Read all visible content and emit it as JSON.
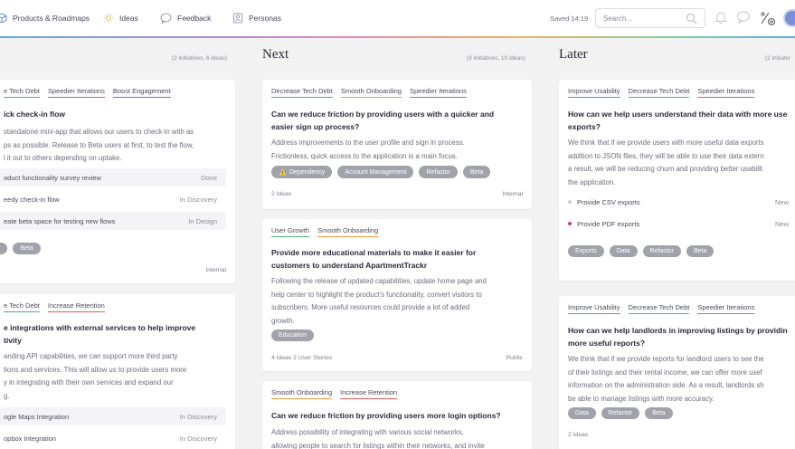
{
  "colors": {
    "tech_debt": "#3fb2a8",
    "speedier": "#e0578d",
    "engagement": "#8a6bd6",
    "onboarding": "#ee9b3c",
    "retention": "#e55a5a",
    "growth": "#4cb77a",
    "usability": "#5b8fd8",
    "new_dot": "#c03d8a",
    "new_dot_light": "#cfcfd6"
  },
  "nav": {
    "products": "Products & Roadmaps",
    "ideas": "Ideas",
    "feedback": "Feedback",
    "personas": "Personas"
  },
  "topbar": {
    "saved": "Saved 14:19",
    "search_placeholder": "Search..."
  },
  "columns": {
    "now": {
      "meta": "(2 initiatives, 6 ideas)",
      "cards": [
        {
          "tags": [
            "e Tech Debt",
            "Speedier Iterations",
            "Boost Engagement"
          ],
          "title": "ick check-in flow",
          "desc": [
            "standalone mini-app that allows our users to check-in with as",
            "ps as possible. Release to Beta users at first, to test the flow,",
            "l it out to others depending on uptake."
          ],
          "subitems": [
            {
              "name": "oduct functionality survey review",
              "status": "Done"
            },
            {
              "name": "eedy check-in flow",
              "status": "In Discovery"
            },
            {
              "name": "eate beta space for testing new flows",
              "status": "In Design"
            }
          ],
          "pills": [
            "r",
            "Beta"
          ],
          "visibility": "Internal"
        },
        {
          "tags": [
            "e Tech Debt",
            "Increase Retention"
          ],
          "title": [
            "e integrations with external services to help improve",
            "tivity"
          ],
          "desc": [
            "anding API capabilities, we can support more third party",
            "tions and services. This will allow us to provide users more",
            "y in integrating with their own services and expand our",
            "g."
          ],
          "subitems": [
            {
              "name": "ogle Maps Integration",
              "status": "In Discovery"
            },
            {
              "name": "opbox Integration",
              "status": "In Discovery"
            }
          ]
        }
      ]
    },
    "next": {
      "title": "Next",
      "meta": "(3 initiatives, 10 ideas)",
      "cards": [
        {
          "tags": [
            "Decrease Tech Debt",
            "Smooth Onboarding",
            "Speedier Iterations"
          ],
          "title": [
            "Can we reduce friction by providing users with a quicker and",
            "easier sign up process?"
          ],
          "desc": [
            "Address improvements to the user profile and sign in process.",
            "Frictionless, quick access to the application is a main focus."
          ],
          "pills": [
            "Dependency",
            "Account Management",
            "Refactor",
            "Beta"
          ],
          "ideas": "2 Ideas",
          "visibility": "Internal"
        },
        {
          "tags": [
            "User Growth",
            "Smooth Onboarding"
          ],
          "title": [
            "Provide more educational materials to make it easier for",
            "customers to understand ApartmentTrackr"
          ],
          "desc": [
            "Following the release of updated capabilities, update home page and",
            "help center to highlight the product's functionality, convert visitors to",
            "subscribers. More useful resources could provide a lot of added",
            "growth."
          ],
          "pills": [
            "Education"
          ],
          "ideas": "4 Ideas  2 User Stories",
          "visibility": "Public"
        },
        {
          "tags": [
            "Smooth Onboarding",
            "Increase Retention"
          ],
          "title": [
            "Can we reduce friction by providing users more login options?"
          ],
          "desc": [
            "Address possibility of integrating with various social networks,",
            "allowing people to search for listings within their networks, and invite"
          ]
        }
      ]
    },
    "later": {
      "title": "Later",
      "meta": "(2 initiativ",
      "cards": [
        {
          "tags": [
            "Improve Usability",
            "Decrease Tech Debt",
            "Speedier Iterations"
          ],
          "title": [
            "How can we help users understand their data with more use",
            "exports?"
          ],
          "desc": [
            "We think that if we provide users with more useful data exports",
            "addition to JSON files, they will be able to use their data extern",
            "a result, we will be reducing churn and providing better usabilit",
            "the application."
          ],
          "subitems": [
            {
              "name": "Provide CSV exports",
              "status": "New"
            },
            {
              "name": "Provide PDF exports",
              "status": "New"
            }
          ],
          "pills": [
            "Exports",
            "Data",
            "Refactor",
            "Beta"
          ]
        },
        {
          "tags": [
            "Improve Usability",
            "Decrease Tech Debt",
            "Speedier Iterations"
          ],
          "title": [
            "How can we help landlords in improving listings by providin",
            "more useful reports?"
          ],
          "desc": [
            "We think that if we provide reports for landlord users to see the",
            "of their listings and their rental income, we can offer more usef",
            "information on the administration side. As a result, landlords sh",
            "be able to manage listings with more accuracy."
          ],
          "pills": [
            "Data",
            "Refactor",
            "Beta"
          ],
          "ideas": "2 Ideas"
        }
      ]
    }
  }
}
